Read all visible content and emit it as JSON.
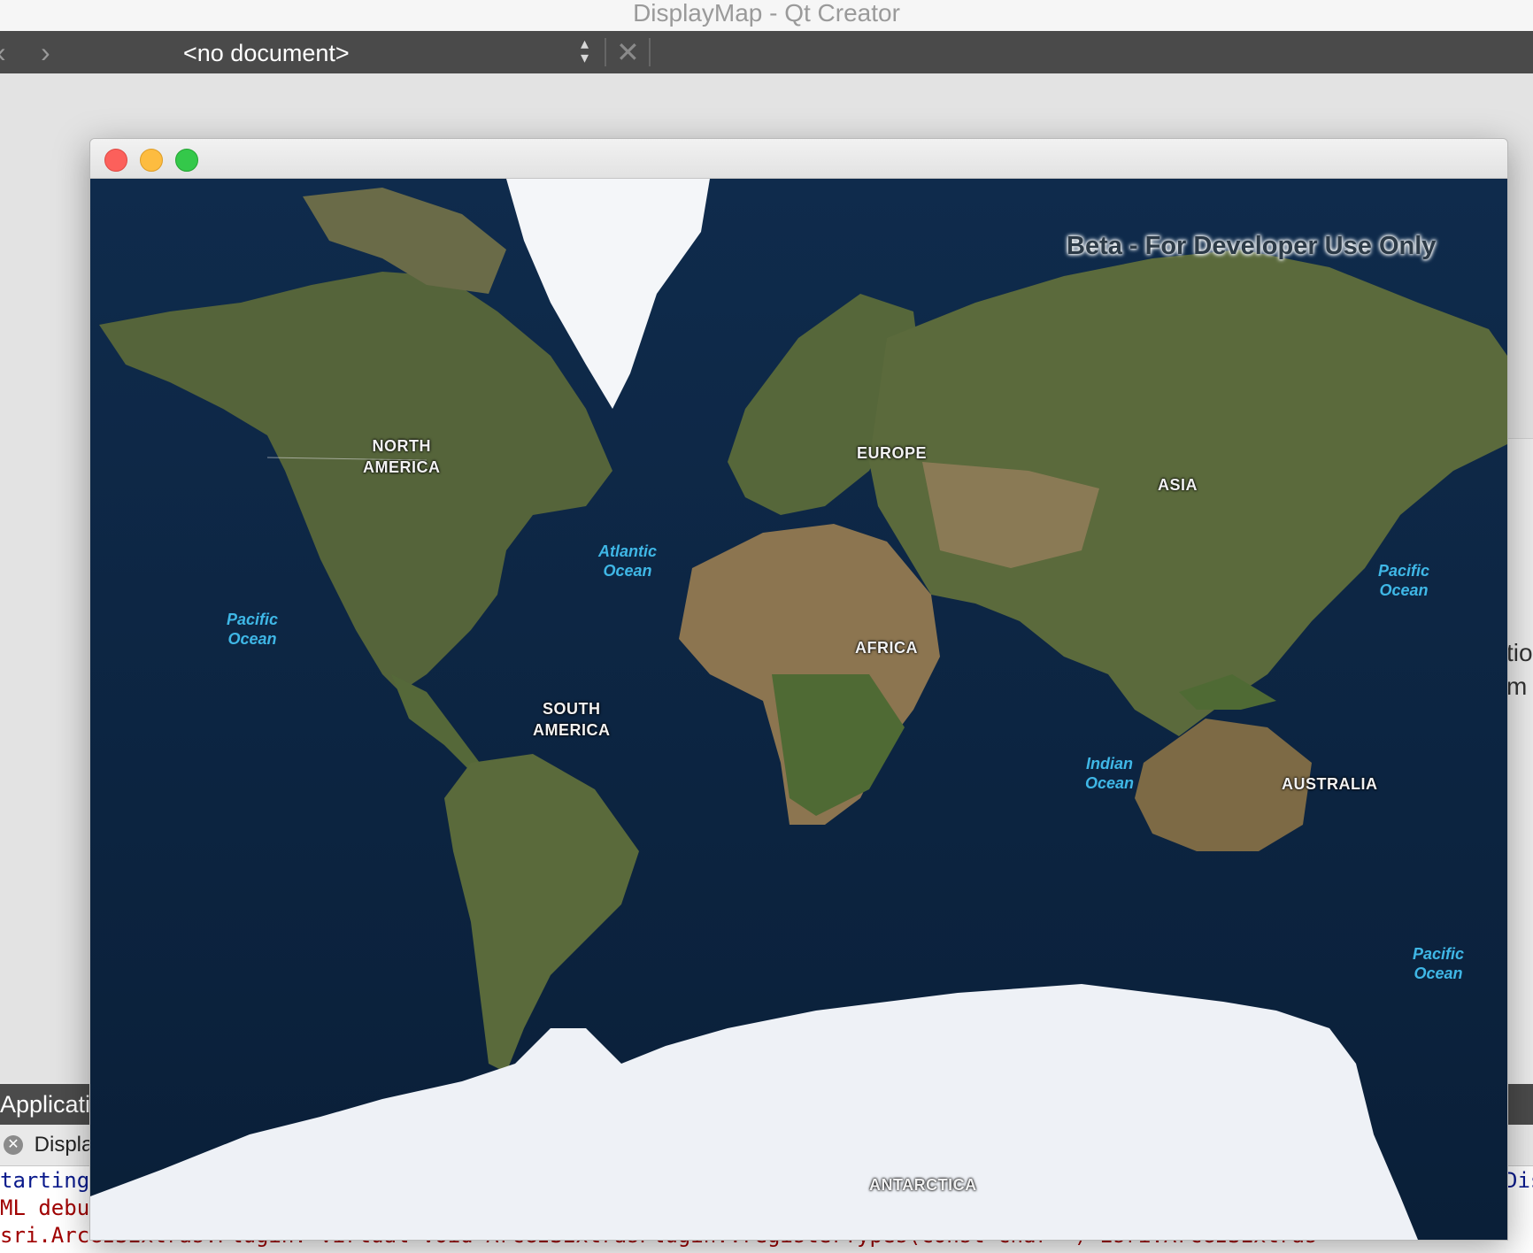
{
  "qt_creator": {
    "window_title": "DisplayMap - Qt Creator",
    "toolbar": {
      "back_icon": "chevron-left-icon",
      "forward_icon": "chevron-right-icon",
      "document_combo": "<no document>",
      "close_icon": "close-icon"
    },
    "right_partial_text": [
      "tio",
      "m"
    ],
    "output_pane": {
      "header_title": "Applicatic",
      "tab_label": "Display",
      "lines": [
        {
          "text": "tarting",
          "color": "#0a1a8c"
        },
        {
          "text": "ML debu",
          "color": "#a00000"
        },
        {
          "text": "sri.ArcGISExtras.Plugin: virtual void ArcGISExtrasPlugin::registerTypes(const char *) Esri.ArcGISExtras",
          "color": "#a00000"
        }
      ],
      "right_partial": "Dis"
    }
  },
  "app_window": {
    "map": {
      "watermark": "Beta - For Developer Use Only",
      "continents": [
        "NORTH\nAMERICA",
        "EUROPE",
        "ASIA",
        "AFRICA",
        "SOUTH\nAMERICA",
        "AUSTRALIA",
        "ANTARCTICA"
      ],
      "oceans": [
        "Atlantic\nOcean",
        "Pacific\nOcean",
        "Pacific\nOcean",
        "Indian\nOcean",
        "Pacific\nOcean"
      ],
      "colors": {
        "ocean": "#0d2744",
        "land": "#4f5f37",
        "desert": "#8c7550",
        "ice": "#eef1f6",
        "ocean_label": "#3fb7e6"
      }
    }
  }
}
